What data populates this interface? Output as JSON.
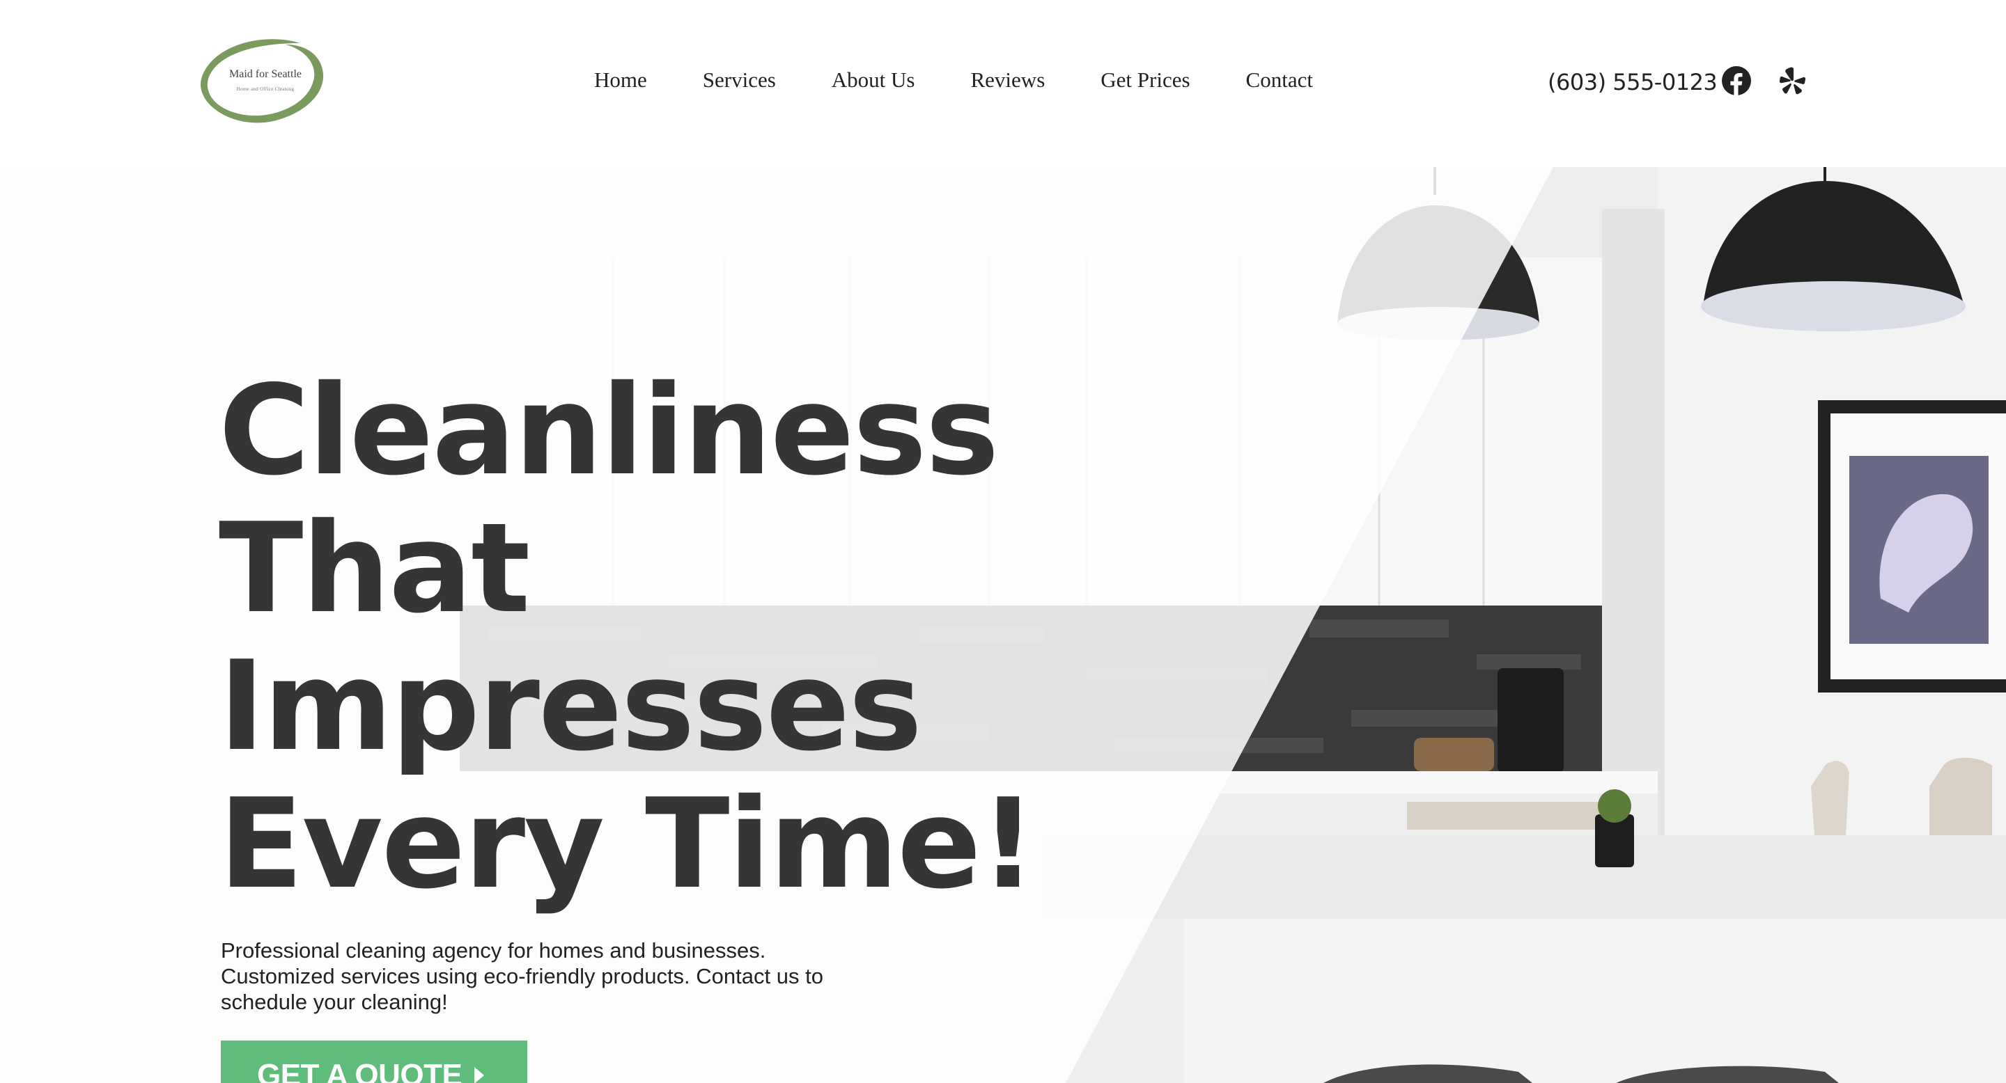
{
  "header": {
    "logo": {
      "name": "Maid for Seattle",
      "tagline": "Home and Office Cleaning",
      "accent_color": "#7a9a5e"
    },
    "nav": [
      {
        "label": "Home"
      },
      {
        "label": "Services"
      },
      {
        "label": "About Us"
      },
      {
        "label": "Reviews"
      },
      {
        "label": "Get Prices"
      },
      {
        "label": "Contact"
      }
    ],
    "phone": "(603) 555-0123",
    "social": [
      {
        "icon": "facebook-icon"
      },
      {
        "icon": "yelp-icon"
      }
    ]
  },
  "hero": {
    "headline_lines": [
      "Cleanliness",
      "That",
      "Impresses",
      "Every Time!"
    ],
    "description": "Professional cleaning agency for homes and businesses. Customized services using eco-friendly products. Contact us to schedule your cleaning!",
    "cta_label": "GET A QUOTE",
    "headline_color": "#363435",
    "cta_color": "#5fbc7a"
  }
}
